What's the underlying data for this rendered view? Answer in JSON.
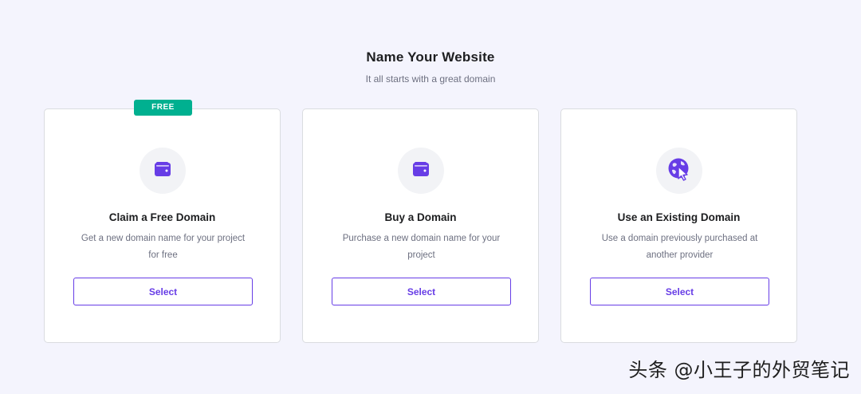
{
  "header": {
    "title": "Name Your Website",
    "subtitle": "It all starts with a great domain"
  },
  "accent_color": "#673de6",
  "badge_color": "#00b090",
  "cards": [
    {
      "badge": "FREE",
      "icon": "wallet-icon",
      "title": "Claim a Free Domain",
      "description": "Get a new domain name for your project for free",
      "button": "Select"
    },
    {
      "icon": "wallet-icon",
      "title": "Buy a Domain",
      "description": "Purchase a new domain name for your project",
      "button": "Select"
    },
    {
      "icon": "globe-cursor-icon",
      "title": "Use an Existing Domain",
      "description": "Use a domain previously purchased at another provider",
      "button": "Select"
    }
  ],
  "watermark": "头条 @小王子的外贸笔记"
}
